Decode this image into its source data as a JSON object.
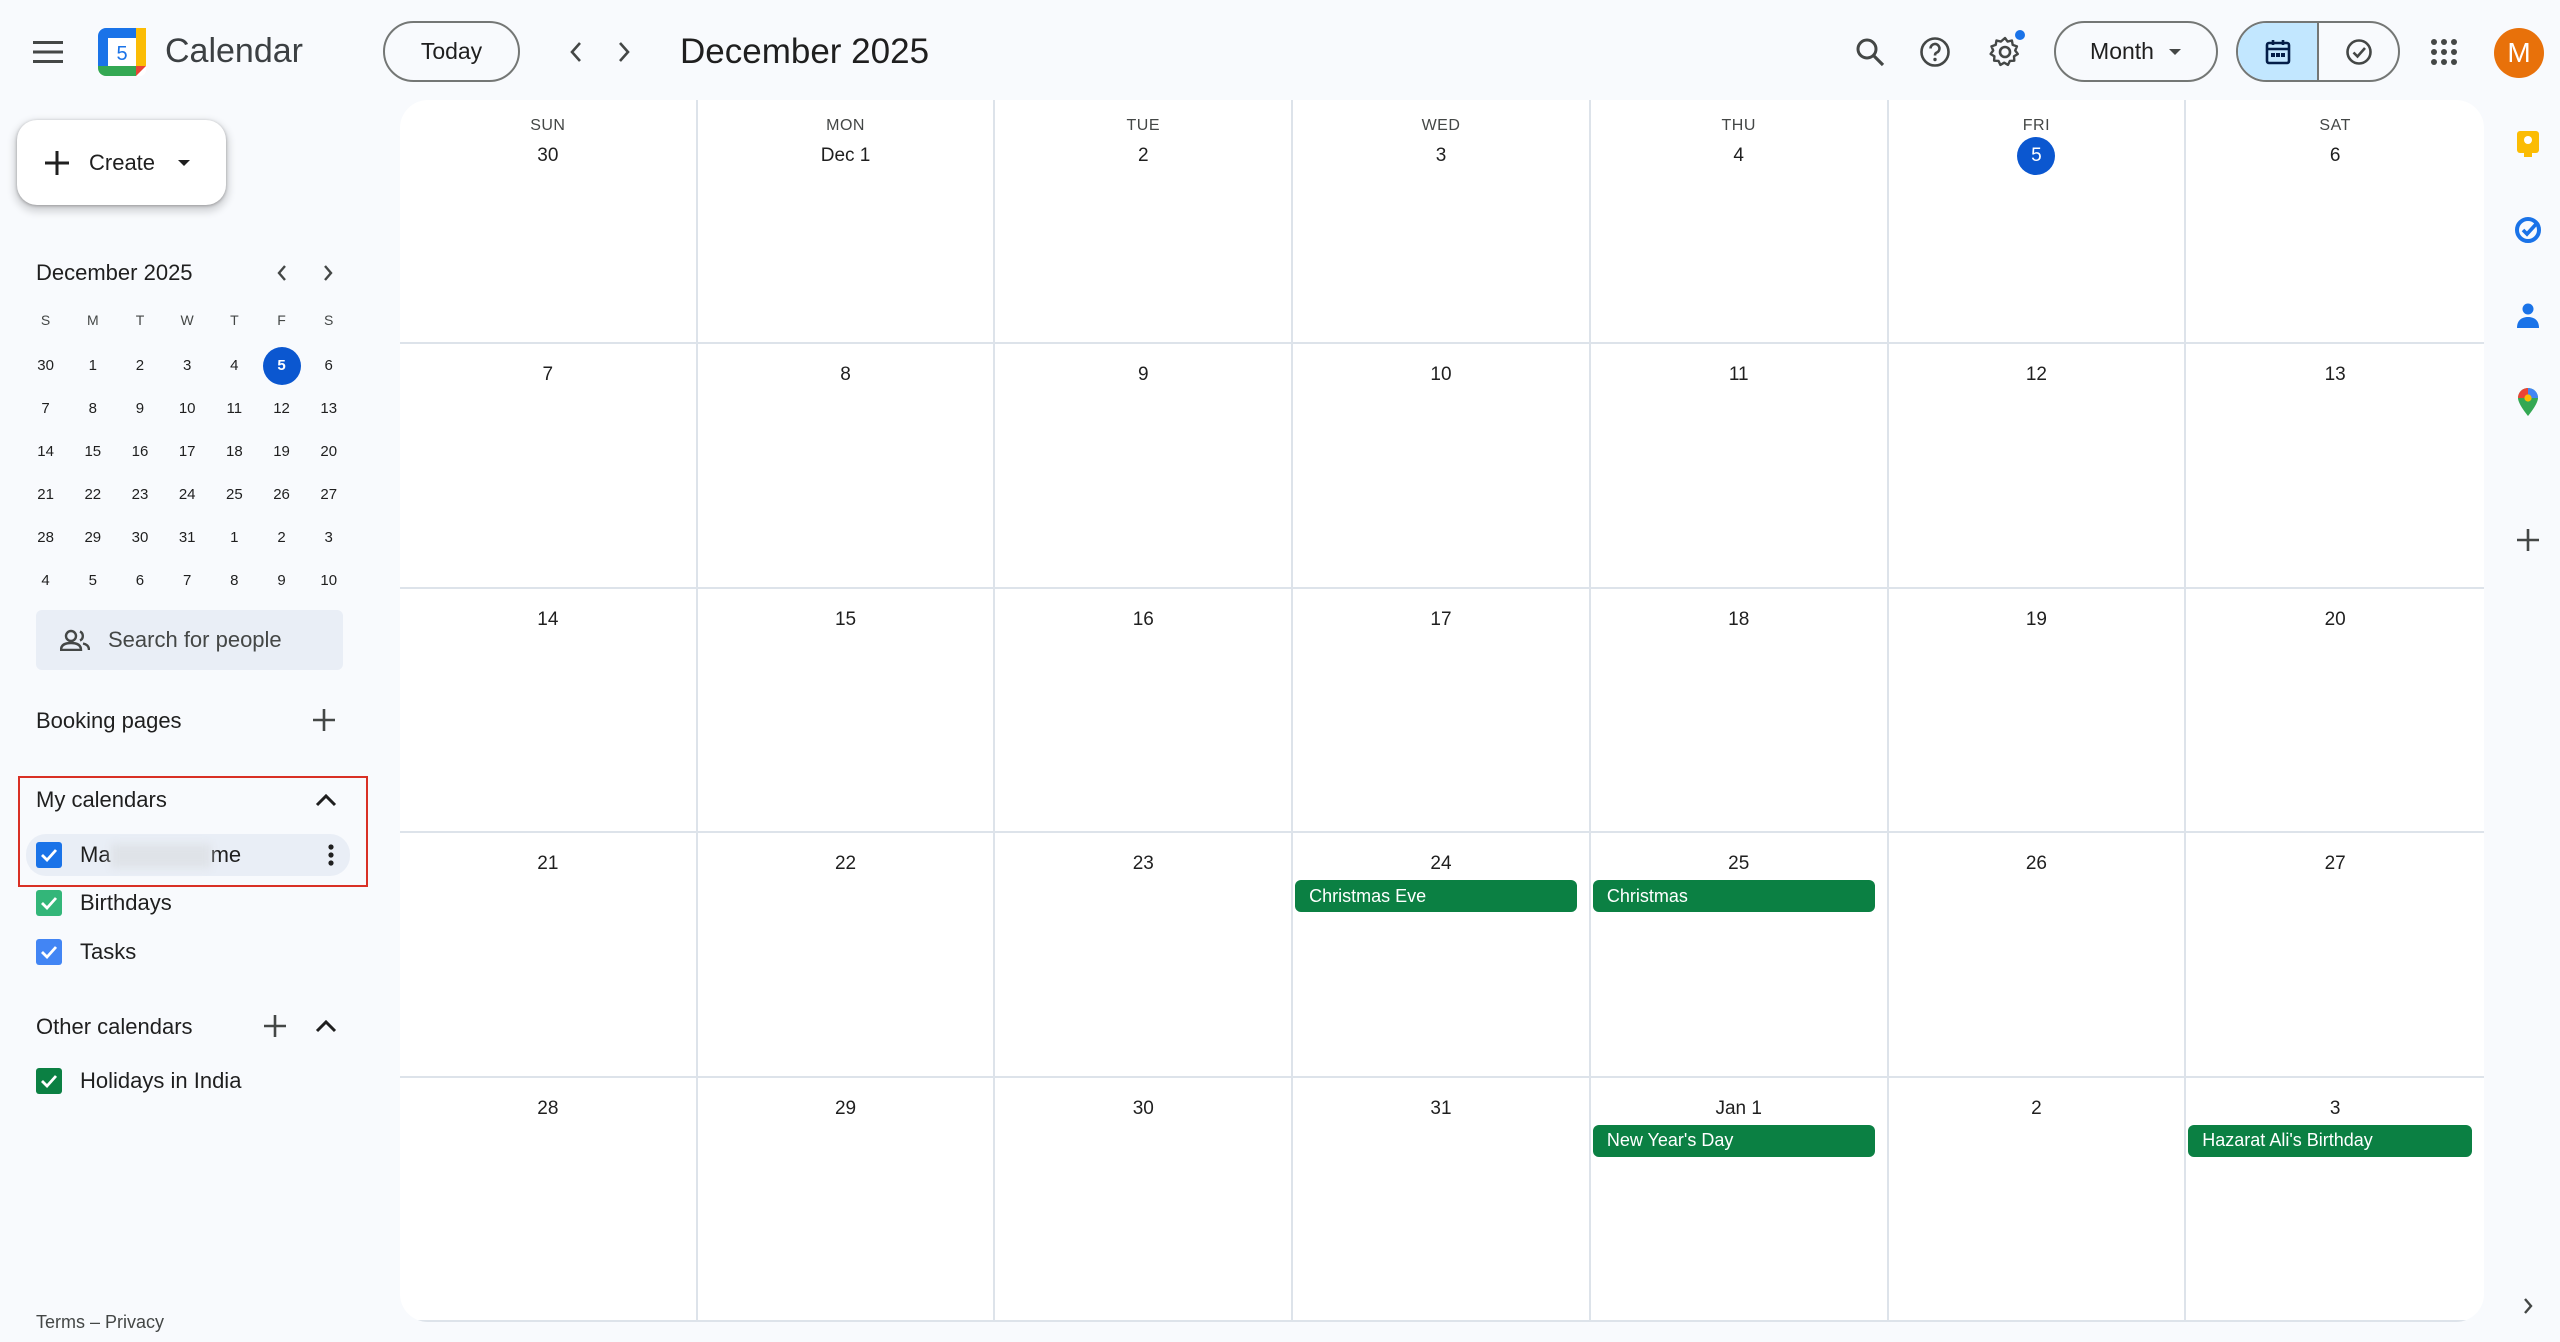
{
  "app": {
    "title": "Calendar",
    "logo_number": "5"
  },
  "toolbar": {
    "today_label": "Today",
    "period_title": "December 2025",
    "view_label": "Month"
  },
  "user": {
    "avatar_initial": "M"
  },
  "sidebar": {
    "create_label": "Create",
    "mini_calendar": {
      "title": "December 2025",
      "weekdays": [
        "S",
        "M",
        "T",
        "W",
        "T",
        "F",
        "S"
      ],
      "weeks": [
        [
          "30",
          "1",
          "2",
          "3",
          "4",
          "5",
          "6"
        ],
        [
          "7",
          "8",
          "9",
          "10",
          "11",
          "12",
          "13"
        ],
        [
          "14",
          "15",
          "16",
          "17",
          "18",
          "19",
          "20"
        ],
        [
          "21",
          "22",
          "23",
          "24",
          "25",
          "26",
          "27"
        ],
        [
          "28",
          "29",
          "30",
          "31",
          "1",
          "2",
          "3"
        ],
        [
          "4",
          "5",
          "6",
          "7",
          "8",
          "9",
          "10"
        ]
      ],
      "selected": "5"
    },
    "people_search_placeholder": "Search for people",
    "booking_pages_label": "Booking pages",
    "my_calendars_label": "My calendars",
    "my_calendars": [
      {
        "label_start": "Ma",
        "label_end": "me",
        "color": "#1a73e8"
      },
      {
        "label": "Birthdays",
        "color": "#33b679"
      },
      {
        "label": "Tasks",
        "color": "#4285f4"
      }
    ],
    "other_calendars_label": "Other calendars",
    "other_calendars": [
      {
        "label": "Holidays in India",
        "color": "#0b8043"
      }
    ],
    "footer": "Terms – Privacy"
  },
  "month_view": {
    "weekday_headers": [
      "SUN",
      "MON",
      "TUE",
      "WED",
      "THU",
      "FRI",
      "SAT"
    ],
    "weeks": [
      [
        "30",
        "Dec 1",
        "2",
        "3",
        "4",
        "5",
        "6"
      ],
      [
        "7",
        "8",
        "9",
        "10",
        "11",
        "12",
        "13"
      ],
      [
        "14",
        "15",
        "16",
        "17",
        "18",
        "19",
        "20"
      ],
      [
        "21",
        "22",
        "23",
        "24",
        "25",
        "26",
        "27"
      ],
      [
        "28",
        "29",
        "30",
        "31",
        "Jan 1",
        "2",
        "3"
      ]
    ],
    "today_cell": {
      "week": 0,
      "day": 5
    },
    "events": [
      {
        "week": 3,
        "day": 3,
        "title": "Christmas Eve"
      },
      {
        "week": 3,
        "day": 4,
        "title": "Christmas"
      },
      {
        "week": 4,
        "day": 4,
        "title": "New Year's Day"
      },
      {
        "week": 4,
        "day": 6,
        "title": "Hazarat Ali's Birthday"
      }
    ],
    "event_color": "#0b8043"
  },
  "colors": {
    "accent": "#0b57d0",
    "selected_view": "#c2e7ff",
    "highlight_border": "#d93025"
  }
}
